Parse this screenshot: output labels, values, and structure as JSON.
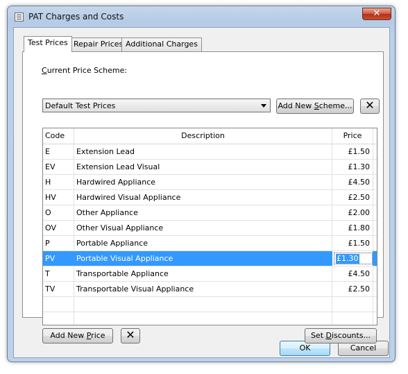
{
  "window": {
    "title": "PAT Charges and Costs",
    "close_glyph": "✕"
  },
  "tabs": [
    "Test Prices",
    "Repair Prices",
    "Additional Charges"
  ],
  "scheme": {
    "label": "Current Price Scheme:",
    "selected": "Default Test Prices",
    "add_button": "Add New Scheme...",
    "delete_glyph": "✕"
  },
  "grid": {
    "columns": [
      "Code",
      "Description",
      "Price"
    ],
    "rows": [
      {
        "code": "E",
        "description": "Extension Lead",
        "price": "£1.50"
      },
      {
        "code": "EV",
        "description": "Extension Lead Visual",
        "price": "£1.30"
      },
      {
        "code": "H",
        "description": "Hardwired Appliance",
        "price": "£4.50"
      },
      {
        "code": "HV",
        "description": "Hardwired Visual Appliance",
        "price": "£2.50"
      },
      {
        "code": "O",
        "description": "Other Appliance",
        "price": "£2.00"
      },
      {
        "code": "OV",
        "description": "Other Visual Appliance",
        "price": "£1.80"
      },
      {
        "code": "P",
        "description": "Portable Appliance",
        "price": "£1.50"
      },
      {
        "code": "PV",
        "description": "Portable Visual Appliance",
        "price": "£1.30"
      },
      {
        "code": "T",
        "description": "Transportable Appliance",
        "price": "£4.50"
      },
      {
        "code": "TV",
        "description": "Transportable Visual Appliance",
        "price": "£2.50"
      }
    ],
    "selected_index": 7
  },
  "buttons": {
    "add_price": "Add New Price",
    "delete_price_glyph": "✕",
    "set_discounts": "Set Discounts...",
    "ok": "OK",
    "cancel": "Cancel"
  }
}
